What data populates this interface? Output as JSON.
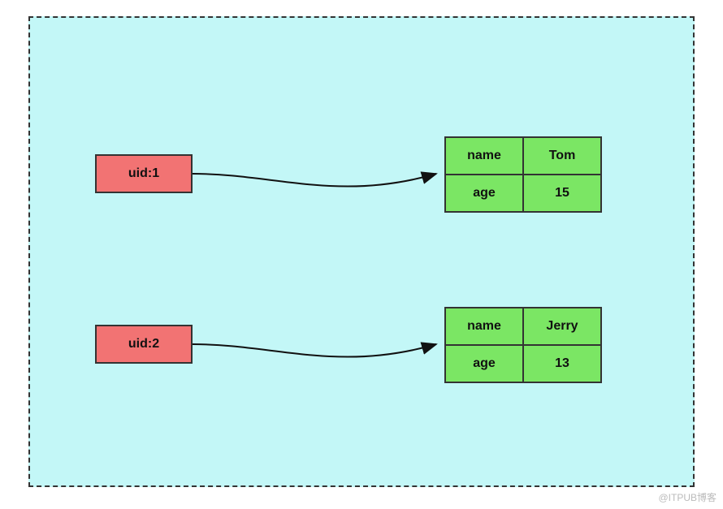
{
  "entries": [
    {
      "uid_label": "uid:1",
      "rows": [
        {
          "key": "name",
          "value": "Tom"
        },
        {
          "key": "age",
          "value": "15"
        }
      ]
    },
    {
      "uid_label": "uid:2",
      "rows": [
        {
          "key": "name",
          "value": "Jerry"
        },
        {
          "key": "age",
          "value": "13"
        }
      ]
    }
  ],
  "watermark": "@ITPUB博客",
  "colors": {
    "canvas_bg": "#c3f7f7",
    "uid_bg": "#f27373",
    "cell_bg": "#7be664",
    "border": "#333"
  }
}
